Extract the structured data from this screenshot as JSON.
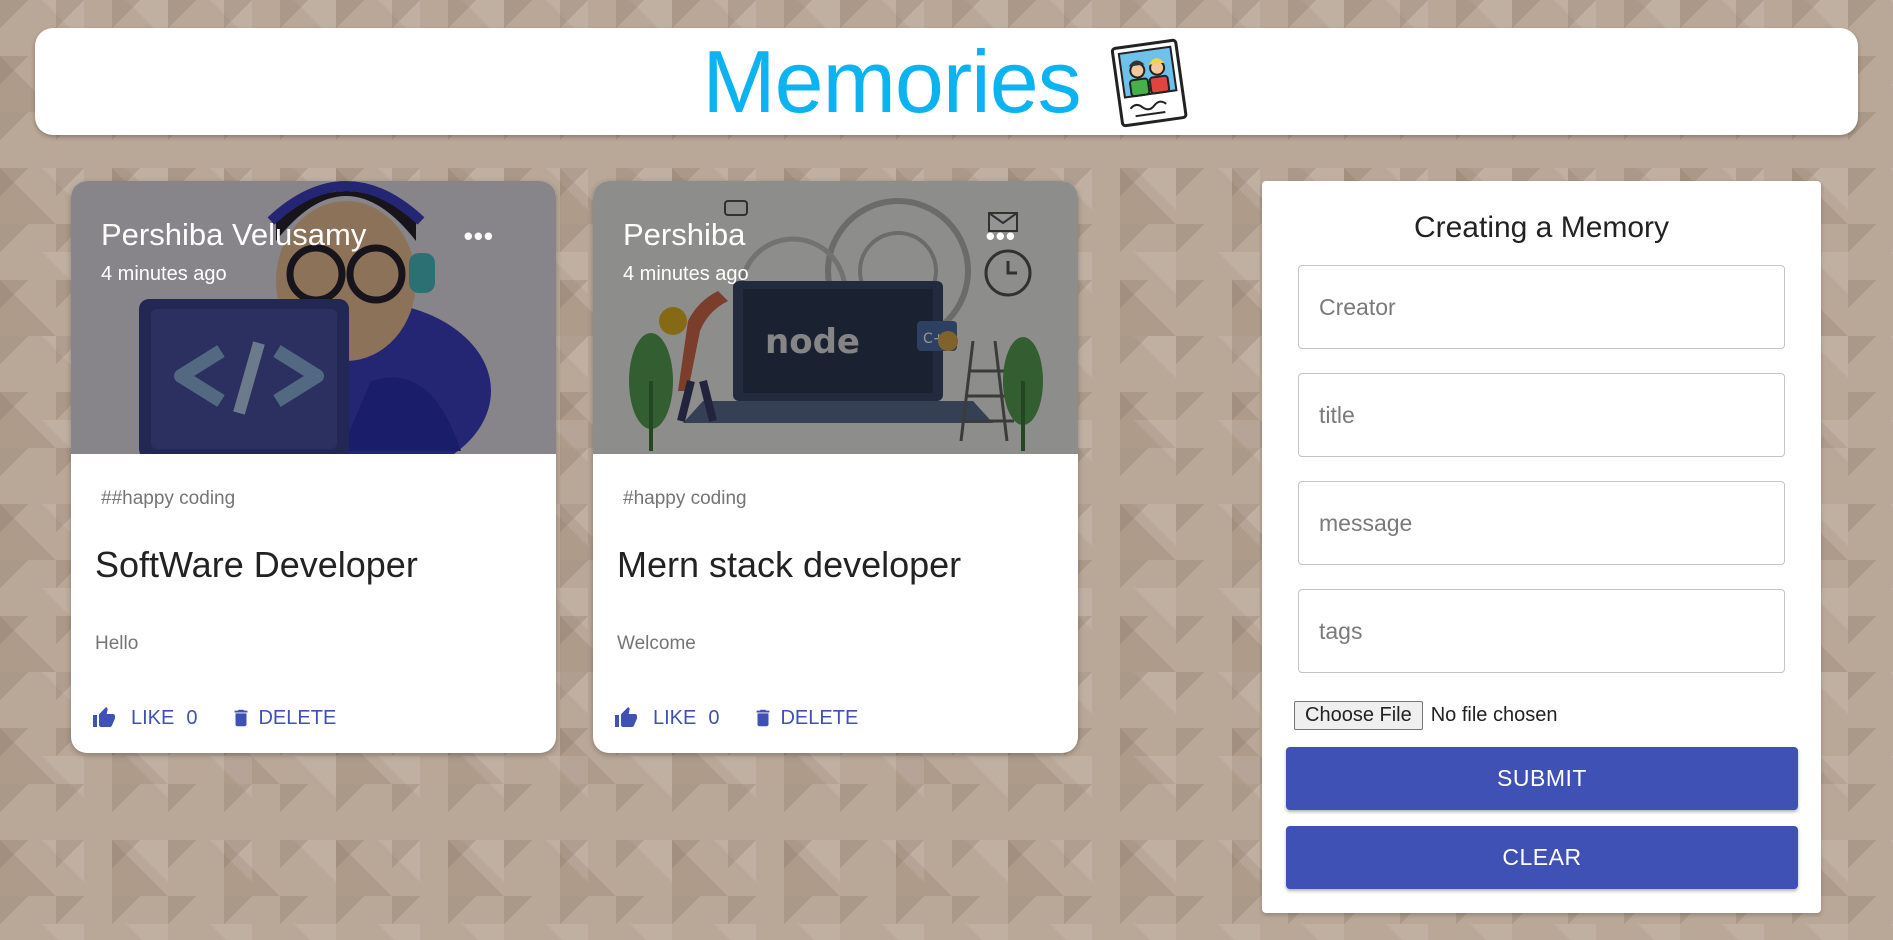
{
  "appbar": {
    "title": "Memories",
    "icon": "photo-memories-icon"
  },
  "posts": [
    {
      "creator": "Pershiba Velusamy",
      "time": "4 minutes ago",
      "more_icon": "more-horizontal-icon",
      "tags": "##happy coding",
      "title": "SoftWare Developer",
      "message": "Hello",
      "like_label": "LIKE",
      "like_count": "0",
      "delete_label": "DELETE",
      "image": "developer-coding-illustration"
    },
    {
      "creator": "Pershiba",
      "time": "4 minutes ago",
      "more_icon": "more-horizontal-icon",
      "tags": "#happy coding",
      "title": "Mern stack developer",
      "message": "Welcome",
      "like_label": "LIKE",
      "like_count": "0",
      "delete_label": "DELETE",
      "image": "node-laptop-illustration",
      "image_text": {
        "node": "node",
        "cpp": "C++"
      }
    }
  ],
  "form": {
    "title": "Creating a Memory",
    "creator_placeholder": "Creator",
    "title_placeholder": "title",
    "message_placeholder": "message",
    "tags_placeholder": "tags",
    "file_button": "Choose File",
    "file_status": "No file chosen",
    "submit_label": "SUBMIT",
    "clear_label": "CLEAR"
  },
  "colors": {
    "brand": "#0bb3f0",
    "primary": "#3f51b5",
    "background": "#b9a797"
  }
}
